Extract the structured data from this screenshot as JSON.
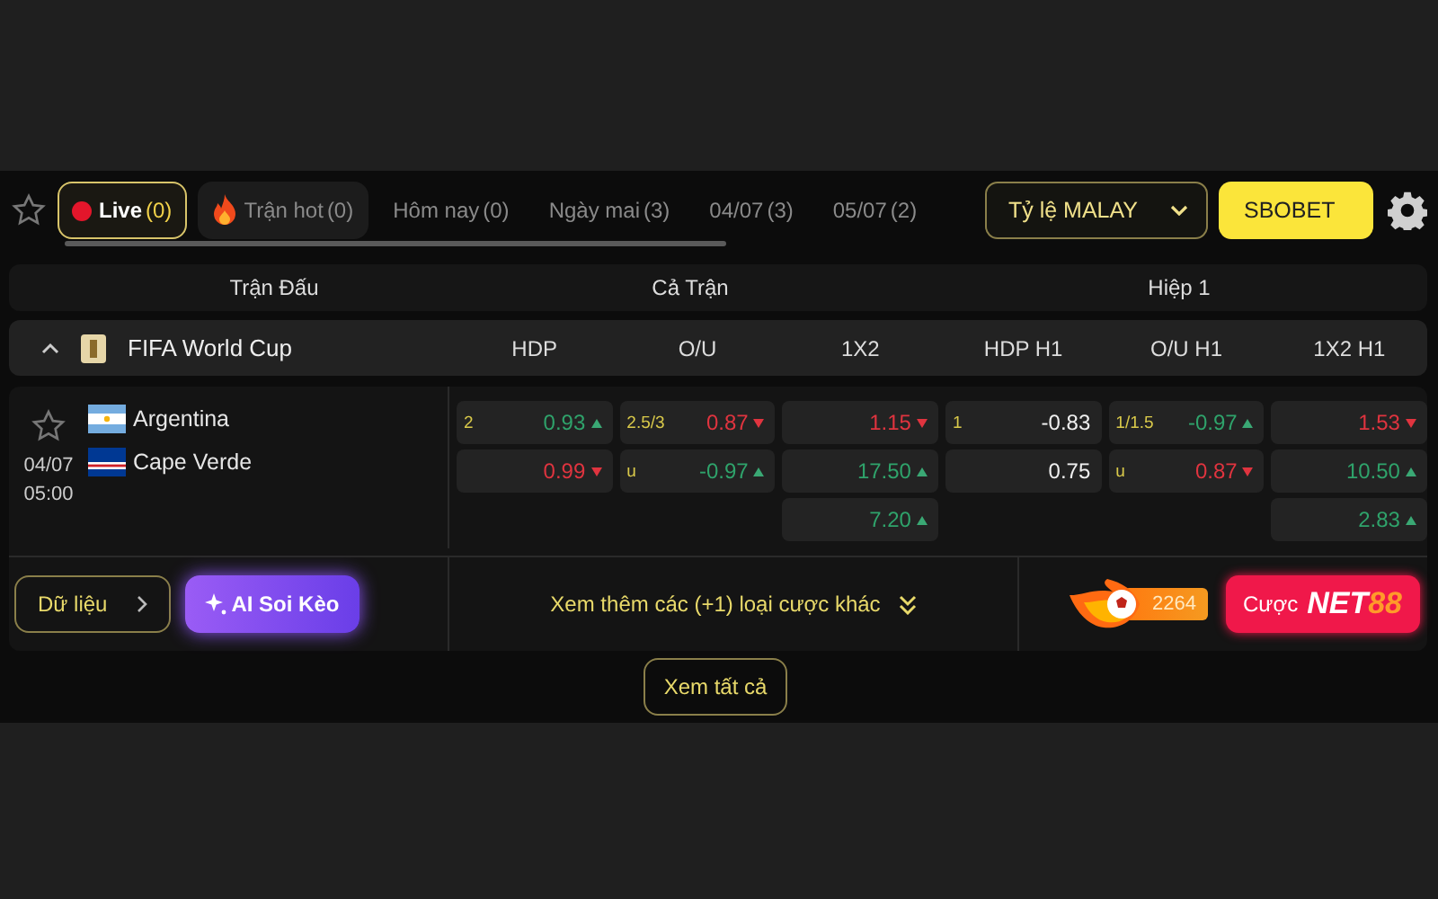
{
  "tabs": [
    {
      "kind": "live",
      "label": "Live",
      "count": "(0)",
      "selected": true
    },
    {
      "kind": "hot",
      "label": "Trận hot",
      "count": "(0)",
      "selected": false
    },
    {
      "kind": "day",
      "label": "Hôm nay",
      "count": "(0)",
      "selected": false
    },
    {
      "kind": "day",
      "label": "Ngày mai",
      "count": "(3)",
      "selected": false
    },
    {
      "kind": "day",
      "label": "04/07",
      "count": "(3)",
      "selected": false
    },
    {
      "kind": "day",
      "label": "05/07",
      "count": "(2)",
      "selected": false
    }
  ],
  "odds_format": {
    "label": "Tỷ lệ MALAY"
  },
  "bookmaker": {
    "label": "SBOBET"
  },
  "header": {
    "match": "Trận Đấu",
    "full_time": "Cả Trận",
    "first_half": "Hiệp 1"
  },
  "league": {
    "name": "FIFA World Cup",
    "expanded": true,
    "markets": [
      "HDP",
      "O/U",
      "1X2",
      "HDP H1",
      "O/U H1",
      "1X2 H1"
    ]
  },
  "match": {
    "date": "04/07",
    "time": "05:00",
    "favorite": false,
    "teams": [
      {
        "name": "Argentina"
      },
      {
        "name": "Cape Verde"
      }
    ],
    "markets": [
      [
        {
          "line": "2",
          "value": "0.93",
          "kind": "up"
        },
        {
          "value": "0.99",
          "kind": "down"
        }
      ],
      [
        {
          "line": "2.5/3",
          "value": "0.87",
          "kind": "down"
        },
        {
          "line": "u",
          "value": "-0.97",
          "kind": "up"
        }
      ],
      [
        {
          "value": "1.15",
          "kind": "down"
        },
        {
          "value": "17.50",
          "kind": "up"
        },
        {
          "value": "7.20",
          "kind": "up"
        }
      ],
      [
        {
          "line": "1",
          "value": "-0.83",
          "kind": "flat"
        },
        {
          "value": "0.75",
          "kind": "flat"
        }
      ],
      [
        {
          "line": "1/1.5",
          "value": "-0.97",
          "kind": "up"
        },
        {
          "line": "u",
          "value": "0.87",
          "kind": "down"
        }
      ],
      [
        {
          "value": "1.53",
          "kind": "down"
        },
        {
          "value": "10.50",
          "kind": "up"
        },
        {
          "value": "2.83",
          "kind": "up"
        }
      ]
    ]
  },
  "footer": {
    "stats_button": "Dữ liệu",
    "ai_button": "AI Soi Kèo",
    "more_bets": "Xem thêm các (+1) loại cược khác",
    "hot_count": "2264",
    "bet_prefix": "Cược",
    "brand_word": "NET",
    "brand_digits": "88"
  },
  "view_all": "Xem tất cả"
}
